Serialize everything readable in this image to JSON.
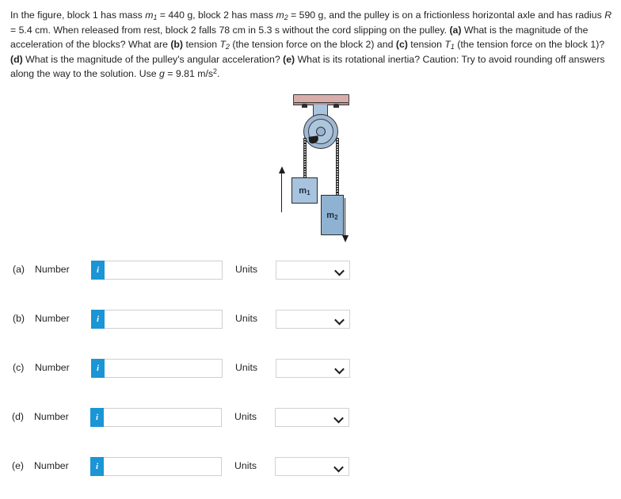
{
  "problem": {
    "intro": "In the figure, block 1 has mass",
    "m1_symbol": "m",
    "m1_sub": "1",
    "m1_value": "= 440 g, block 2 has mass",
    "m2_symbol": "m",
    "m2_sub": "2",
    "m2_value": "= 590 g, and the pulley is on a frictionless horizontal axle and has radius",
    "R_symbol": "R",
    "R_value": "= 5.4 cm. When released from rest, block 2 falls 78 cm in 5.3 s without the cord slipping on the pulley.",
    "part_a_tag": "(a)",
    "part_a_text": "What is the magnitude of the acceleration of the blocks? What are",
    "part_b_tag": "(b)",
    "part_b_text_pre": "tension",
    "T2_symbol": "T",
    "T2_sub": "2",
    "part_b_text_post": "(the tension force on the block 2) and",
    "part_c_tag": "(c)",
    "part_c_text_pre": "tension",
    "T1_symbol": "T",
    "T1_sub": "1",
    "part_c_text_post": "(the tension force on the block 1)?",
    "part_d_tag": "(d)",
    "part_d_text": "What is the magnitude of the pulley's angular acceleration?",
    "part_e_tag": "(e)",
    "part_e_text": "What is its rotational inertia? Caution: Try to avoid rounding off answers along the way to the solution. Use",
    "g_symbol": "g",
    "g_value_pre": "= 9.81 m/s",
    "g_exponent": "2",
    "g_value_post": "."
  },
  "figure": {
    "block1_label": "m",
    "block1_sub": "1",
    "block2_label": "m",
    "block2_sub": "2",
    "ceiling_color": "#d9aeaa",
    "block1_color": "#a7c3dd",
    "block2_color": "#8fb2d2",
    "pulley_color": "#9fb8d4"
  },
  "answers": {
    "info_glyph": "i",
    "accent_color": "#1b95d5",
    "rows": [
      {
        "letter": "(a)",
        "number_label": "Number",
        "value": "",
        "placeholder": "",
        "units_label": "Units",
        "units_value": ""
      },
      {
        "letter": "(b)",
        "number_label": "Number",
        "value": "",
        "placeholder": "",
        "units_label": "Units",
        "units_value": ""
      },
      {
        "letter": "(c)",
        "number_label": "Number",
        "value": "",
        "placeholder": "",
        "units_label": "Units",
        "units_value": ""
      },
      {
        "letter": "(d)",
        "number_label": "Number",
        "value": "",
        "placeholder": "",
        "units_label": "Units",
        "units_value": ""
      },
      {
        "letter": "(e)",
        "number_label": "Number",
        "value": "",
        "placeholder": "",
        "units_label": "Units",
        "units_value": ""
      }
    ]
  }
}
